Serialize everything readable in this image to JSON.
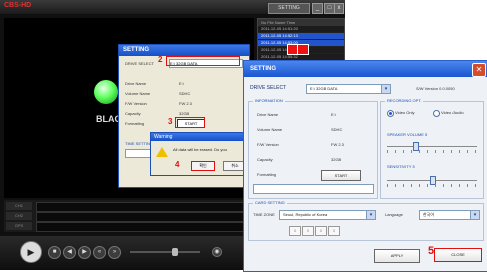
{
  "player": {
    "title": "CBS-HD",
    "top_label": "SETTING",
    "video_text": "BLACK",
    "file_list": {
      "headers": "No  File Name  Time",
      "rows": [
        "2011-12-05 14:51:20",
        "2011-12-05 14:52:13",
        "2011-12-05 14:53:00",
        "2011-12-05 14:54:10",
        "2011-12-05 14:55:32",
        "2011-12-05 14:56:47",
        "2011-12-05 14:58:02",
        "2011-12-05 14:59:15"
      ]
    },
    "tracks": [
      "CH1",
      "CH2",
      "GPS"
    ],
    "controls": [
      "play",
      "stop",
      "prev",
      "next",
      "rew",
      "ff"
    ]
  },
  "back_dialog": {
    "title": "SETTING",
    "drive_select_label": "DRIVE SELECT",
    "drive_value": "E:\\ 32GB DATA",
    "rows": [
      "Drive Name",
      "Volume Name",
      "F/W Version",
      "Capacity",
      "Formatting"
    ],
    "values": [
      "E:\\",
      "SDHC",
      "FW 2.3",
      "32GB",
      ""
    ],
    "start_label": "START",
    "time_label": "TIME SETTING"
  },
  "warning": {
    "title": "Warning",
    "message": "All data will be erased. Do you",
    "ok": "확인",
    "cancel": "취소"
  },
  "annotations": [
    "2",
    "3",
    "4",
    "5"
  ],
  "main_dialog": {
    "title": "SETTING",
    "drive_select_label": "DRIVE SELECT",
    "drive_value": "E:\\ 32GB DATA",
    "version_label": "S/W Version 0.0.0050",
    "info_group": "INFORMATION",
    "info_rows": [
      {
        "label": "Drive Name",
        "value": "E:\\"
      },
      {
        "label": "Volume Name",
        "value": "SDHC"
      },
      {
        "label": "F/W Version",
        "value": "FW 2.3"
      },
      {
        "label": "Capacity",
        "value": "32GB"
      },
      {
        "label": "Formatting",
        "value": ""
      }
    ],
    "start_label": "START",
    "rec_group": "RECORDING OPT.",
    "rec_options": [
      "Video Only",
      "Video /Audio"
    ],
    "speaker_label": "SPEAKER VOLUME 5",
    "speaker_level": 0.3,
    "sensitivity_label": "SENSITIVITY 5",
    "sensitivity_level": 0.5,
    "card_group": "CARD SETTING",
    "timezone_label": "TIME ZONE",
    "timezone_value": "Seoul, Republic of Korea",
    "language_label": "Language",
    "language_value": "한국어",
    "spin_values": [
      "0",
      "0",
      "0",
      "0"
    ],
    "apply_label": "APPLY",
    "close_label": "CLOSE"
  },
  "colors": {
    "annotation_red": "#e01010",
    "title_blue": "#1a56d0",
    "indicator_green": "#5cff5c"
  }
}
